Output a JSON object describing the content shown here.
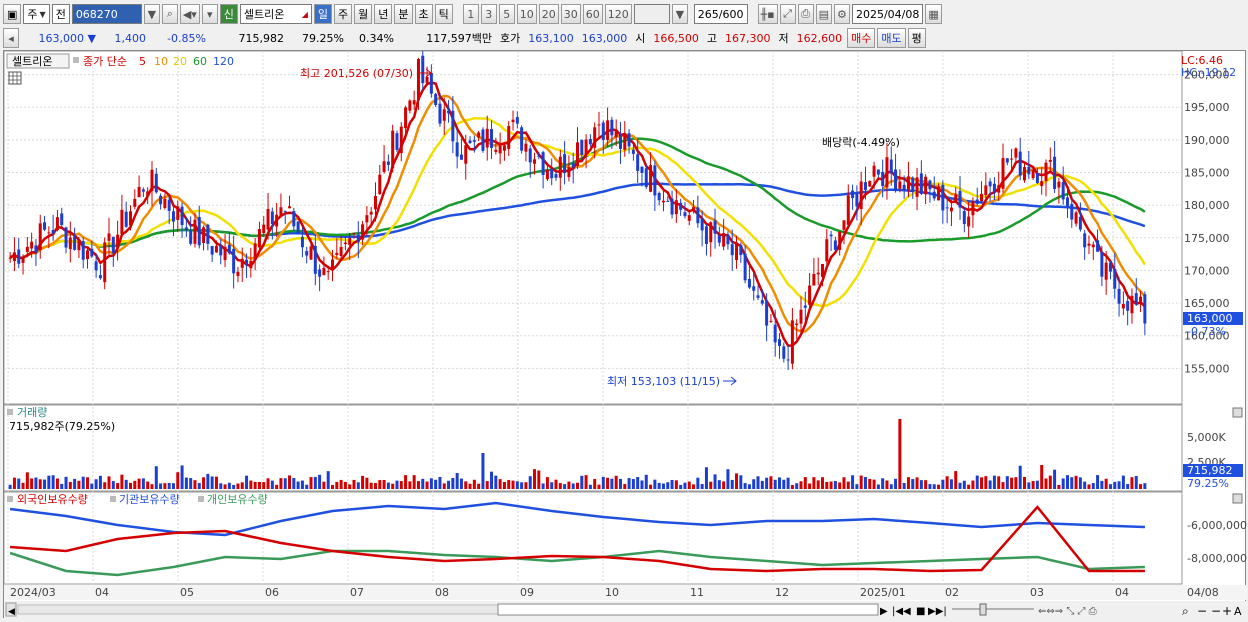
{
  "toolbar": {
    "market": "주",
    "period_type": "전",
    "code": "068270",
    "badge": "신",
    "name": "셀트리온",
    "intervals": [
      "일",
      "주",
      "월",
      "년",
      "분",
      "초",
      "틱"
    ],
    "active_interval": "일",
    "minute_units": [
      "1",
      "3",
      "5",
      "10",
      "20",
      "30",
      "60",
      "120"
    ],
    "count": "265",
    "count_total": "/600",
    "date": "2025/04/08"
  },
  "info": {
    "price": "163,000",
    "change": "1,400",
    "change_pct": "-0.85%",
    "volume": "715,982",
    "volume_ratio": "79.25%",
    "turnover": "0.34%",
    "amount": "117,597백만",
    "bid_label": "호가",
    "bid": "163,100",
    "ask": "163,000",
    "open_label": "시",
    "open": "166,500",
    "high_label": "고",
    "high": "167,300",
    "low_label": "저",
    "low": "162,600",
    "buy_btn": "매수",
    "sell_btn": "매도",
    "eval_btn": "평"
  },
  "price_panel": {
    "stock_label": "셀트리온",
    "ma_title": "종가 단순",
    "ma_periods": [
      "5",
      "10",
      "20",
      "60",
      "120"
    ],
    "lc": "LC:6.46",
    "hc": "HC:-19.12",
    "y_ticks": [
      "200,000",
      "195,000",
      "190,000",
      "185,000",
      "180,000",
      "175,000",
      "170,000",
      "165,000",
      "160,000",
      "155,000"
    ],
    "cur_price_tag": "163,000",
    "cur_pct_tag": "-0.73%",
    "high_annot": "최고 201,526 (07/30)",
    "low_annot": "최저 153,103 (11/15)",
    "div_annot": "배당락(-4.49%)"
  },
  "volume_panel": {
    "title": "거래량",
    "value": "715,982주(79.25%)",
    "y_ticks": [
      "5,000K",
      "2,500K"
    ],
    "cur_tag": "715,982",
    "cur_pct": "79.25%"
  },
  "holding_panel": {
    "series": [
      "외국인보유수량",
      "기관보유수량",
      "개인보유수량"
    ],
    "y_ticks": [
      "-6,000,000",
      "-8,000,000"
    ]
  },
  "x_axis": {
    "labels": [
      "2024/03",
      "04",
      "05",
      "06",
      "07",
      "08",
      "09",
      "10",
      "11",
      "12",
      "2025/01",
      "02",
      "03",
      "04"
    ],
    "right_label": "04/08"
  },
  "colors": {
    "up": "#d40000",
    "down": "#1a3fd0",
    "ma5": "#d40000",
    "ma10": "#f08c00",
    "ma20": "#f2e000",
    "ma60": "#1a9a2a",
    "ma120": "#2050e0",
    "foreign": "#d40000",
    "institution": "#2050e0",
    "individual": "#3a9a5a"
  },
  "chart_data": {
    "type": "line",
    "candles_approx_close": [
      {
        "x": "2024/03",
        "y": 172000
      },
      {
        "x": "2024/04",
        "y": 177000
      },
      {
        "x": "2024/04b",
        "y": 171000
      },
      {
        "x": "2024/05",
        "y": 184000
      },
      {
        "x": "2024/05b",
        "y": 176000
      },
      {
        "x": "2024/06",
        "y": 171000
      },
      {
        "x": "2024/06b",
        "y": 180000
      },
      {
        "x": "2024/07",
        "y": 168000
      },
      {
        "x": "2024/07b",
        "y": 181000
      },
      {
        "x": "2024/07/30",
        "y": 200000
      },
      {
        "x": "2024/08",
        "y": 188000
      },
      {
        "x": "2024/08b",
        "y": 192000
      },
      {
        "x": "2024/09",
        "y": 185000
      },
      {
        "x": "2024/09b",
        "y": 193000
      },
      {
        "x": "2024/10",
        "y": 185000
      },
      {
        "x": "2024/10b",
        "y": 178000
      },
      {
        "x": "2024/11",
        "y": 172000
      },
      {
        "x": "2024/11/15",
        "y": 156000
      },
      {
        "x": "2024/12",
        "y": 173000
      },
      {
        "x": "2024/12b",
        "y": 186000
      },
      {
        "x": "2025/01",
        "y": 183000
      },
      {
        "x": "2025/02",
        "y": 179000
      },
      {
        "x": "2025/03",
        "y": 187000
      },
      {
        "x": "2025/03b",
        "y": 185000
      },
      {
        "x": "2025/04",
        "y": 170000
      },
      {
        "x": "2025/04/08",
        "y": 163000
      }
    ],
    "high": {
      "date": "07/30",
      "value": 201526
    },
    "low": {
      "date": "11/15",
      "value": 153103
    },
    "ylim": [
      150000,
      203000
    ]
  }
}
